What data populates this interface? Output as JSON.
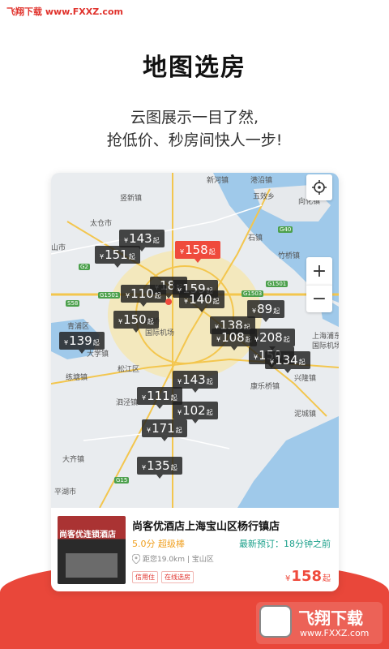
{
  "watermark_top": "飞翔下载 www.FXXZ.com",
  "hero": {
    "title": "地图选房",
    "subtitle_line1": "云图展示一目了然,",
    "subtitle_line2": "抢低价、秒房间快人一步!"
  },
  "map": {
    "places": [
      "新河镇",
      "港沿镇",
      "五效乡",
      "竖新镇",
      "向化镇",
      "太仓市",
      "山市",
      "石镇",
      "G40",
      "竹桥镇",
      "G1501",
      "G2",
      "S58",
      "G1501",
      "G1503",
      "青浦区",
      "大学镇",
      "虹桥",
      "国际机场",
      "松江区",
      "练塘镇",
      "泗泾镇",
      "上海浦东",
      "国际机场",
      "康乐桥镇",
      "兴隆镇",
      "泥城镇",
      "大齐镇",
      "平湖市",
      "G15"
    ],
    "pins": [
      {
        "price": "143"
      },
      {
        "price": "151"
      },
      {
        "price": "158",
        "highlight": true
      },
      {
        "price": "18"
      },
      {
        "price": "159"
      },
      {
        "price": "110"
      },
      {
        "price": "140"
      },
      {
        "price": "89"
      },
      {
        "price": "150"
      },
      {
        "price": "138"
      },
      {
        "price": "139"
      },
      {
        "price": "108"
      },
      {
        "price": "208"
      },
      {
        "price": "150"
      },
      {
        "price": "134"
      },
      {
        "price": "143"
      },
      {
        "price": "111"
      },
      {
        "price": "102"
      },
      {
        "price": "171"
      },
      {
        "price": "135"
      }
    ],
    "currency": "¥",
    "suffix": "起",
    "zoom_in": "+",
    "zoom_out": "−"
  },
  "hotel": {
    "name": "尚客优酒店上海宝山区杨行镇店",
    "score": "5.0分",
    "level": "超级棒",
    "booking": "最新预订：18分钟之前",
    "distance": "距您19.0km | 宝山区",
    "tags": [
      "信用住",
      "在线选房"
    ],
    "price_currency": "¥",
    "price": "158",
    "price_suffix": "起",
    "thumb_sign": "尚客优连锁酒店"
  },
  "logo": {
    "title": "飞翔下载",
    "url": "www.FXXZ.com"
  },
  "colors": {
    "accent": "#ef4a3c",
    "teal": "#1aa08a",
    "gold": "#f0a020"
  }
}
